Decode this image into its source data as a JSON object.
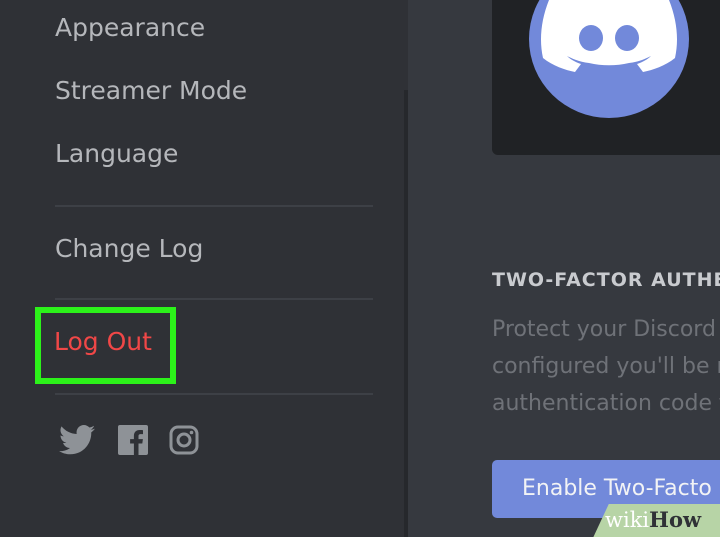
{
  "sidebar": {
    "items": [
      {
        "label": "Appearance"
      },
      {
        "label": "Streamer Mode"
      },
      {
        "label": "Language"
      },
      {
        "label": "Change Log"
      }
    ],
    "logout_label": "Log Out",
    "social_icons": [
      "twitter-icon",
      "facebook-icon",
      "instagram-icon"
    ]
  },
  "main": {
    "avatar_icon": "discord-logo-icon",
    "two_factor": {
      "heading": "TWO-FACTOR AUTHE",
      "description_lines": [
        "Protect your Discord",
        "configured you'll be r",
        "authentication code f"
      ],
      "enable_button_label": "Enable Two-Facto"
    }
  },
  "watermark": {
    "wiki": "wiki",
    "how": "How"
  },
  "colors": {
    "sidebar_bg": "#2f3136",
    "main_bg": "#36393f",
    "blurple": "#7289da",
    "logout_red": "#f04747",
    "highlight_green": "#2cf21a"
  }
}
